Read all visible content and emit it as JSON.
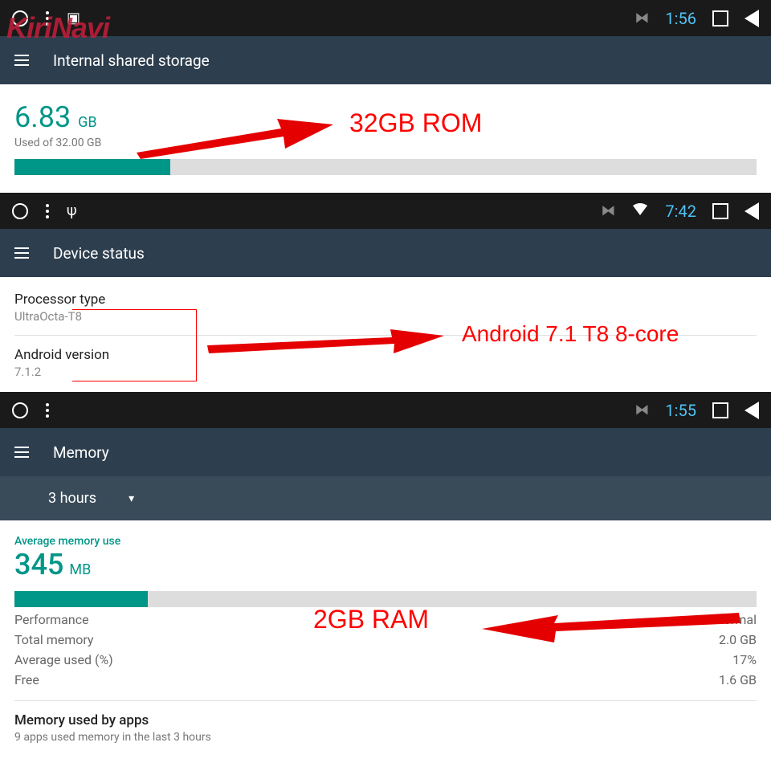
{
  "watermark": "KiriNavi",
  "section1": {
    "status_time": "1:56",
    "header_title": "Internal shared storage",
    "used_value": "6.83",
    "used_unit": "GB",
    "used_sub": "Used of 32.00 GB",
    "progress_pct": 21,
    "annotation": "32GB ROM"
  },
  "section2": {
    "status_time": "7:42",
    "header_title": "Device status",
    "proc_label": "Processor type",
    "proc_value": "UltraOcta-T8",
    "ver_label": "Android version",
    "ver_value": "7.1.2",
    "annotation": "Android 7.1 T8  8-core"
  },
  "section3": {
    "status_time": "1:55",
    "header_title": "Memory",
    "dropdown": "3 hours",
    "avg_label": "Average memory use",
    "avg_value": "345",
    "avg_unit": "MB",
    "progress_pct": 18,
    "stats": {
      "perf_label": "Performance",
      "perf_val": "Normal",
      "total_label": "Total memory",
      "total_val": "2.0 GB",
      "avgpct_label": "Average used (%)",
      "avgpct_val": "17%",
      "free_label": "Free",
      "free_val": "1.6 GB"
    },
    "apps_title": "Memory used by apps",
    "apps_sub": "9 apps used memory in the last 3 hours",
    "annotation": "2GB RAM"
  }
}
